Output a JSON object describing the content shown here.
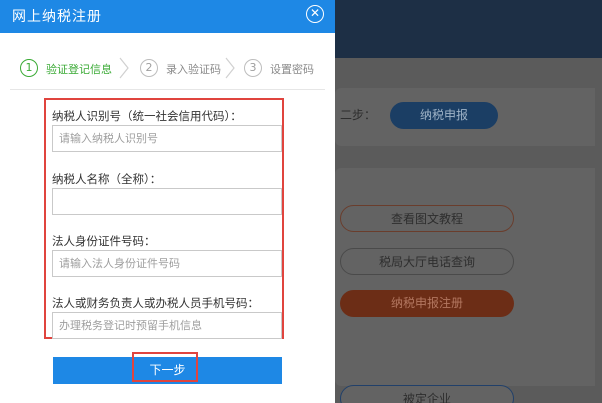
{
  "modal": {
    "title": "网上纳税注册",
    "close_icon": "close-circle-icon"
  },
  "steps": [
    {
      "num": "1",
      "label": "验证登记信息",
      "state": "active"
    },
    {
      "num": "2",
      "label": "录入验证码",
      "state": "pending"
    },
    {
      "num": "3",
      "label": "设置密码",
      "state": "pending"
    }
  ],
  "form": {
    "taxid": {
      "label": "纳税人识别号（统一社会信用代码）：",
      "placeholder": "请输入纳税人识别号",
      "value": ""
    },
    "name": {
      "label": "纳税人名称（全称）：",
      "placeholder": "",
      "value": ""
    },
    "idcard": {
      "label": "法人身份证件号码：",
      "placeholder": "请输入法人身份证件号码",
      "value": ""
    },
    "phone": {
      "label": "法人或财务负责人或办税人员手机号码：",
      "placeholder": "办理税务登记时预留手机信息",
      "value": ""
    }
  },
  "next_button": {
    "label": "下一步"
  },
  "background": {
    "step_label": "二步：",
    "report_button": "纳税申报",
    "tutorial_button": "查看图文教程",
    "phone_button": "税局大厅电话查询",
    "register_button": "纳税申报注册",
    "enterprise_button": "被定企业"
  },
  "colors": {
    "primary": "#1e88e5",
    "active_step": "#3aaa35",
    "highlight_border": "#e0443e"
  }
}
